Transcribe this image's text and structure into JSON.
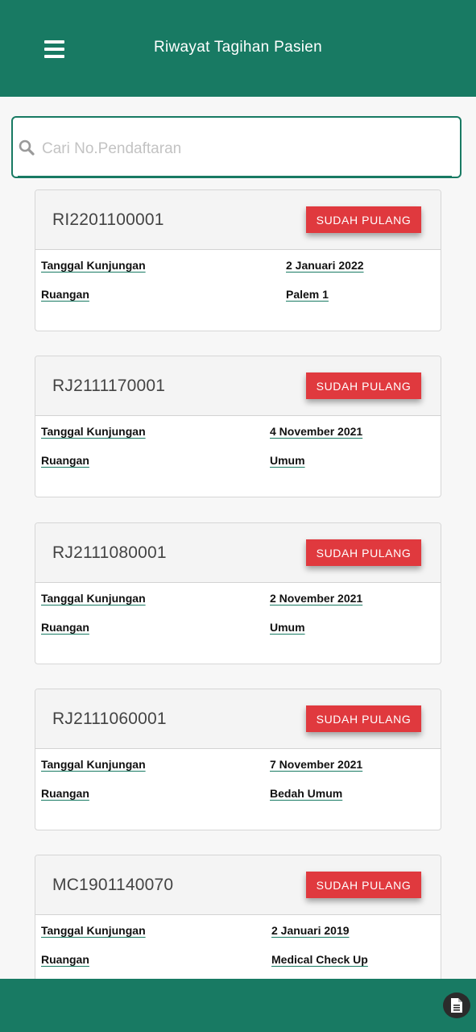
{
  "header": {
    "title": "Riwayat Tagihan Pasien"
  },
  "search": {
    "placeholder": "Cari No.Pendaftaran",
    "value": ""
  },
  "labels": {
    "visit_date": "Tanggal Kunjungan",
    "room": "Ruangan"
  },
  "cards": [
    {
      "reg_no": "RI2201100001",
      "status": "SUDAH PULANG",
      "visit_date": "2 Januari 2022",
      "room": "Palem 1"
    },
    {
      "reg_no": "RJ2111170001",
      "status": "SUDAH PULANG",
      "visit_date": "4 November 2021",
      "room": "Umum"
    },
    {
      "reg_no": "RJ2111080001",
      "status": "SUDAH PULANG",
      "visit_date": "2 November 2021",
      "room": "Umum"
    },
    {
      "reg_no": "RJ2111060001",
      "status": "SUDAH PULANG",
      "visit_date": "7 November 2021",
      "room": "Bedah Umum"
    },
    {
      "reg_no": "MC1901140070",
      "status": "SUDAH PULANG",
      "visit_date": "2 Januari 2019",
      "room": "Medical Check Up"
    }
  ],
  "icons": {
    "menu": "hamburger-icon",
    "search": "search-icon",
    "document": "document-icon"
  },
  "colors": {
    "primary": "#187a63",
    "status": "#e0393e",
    "background": "#f7f7f7"
  }
}
